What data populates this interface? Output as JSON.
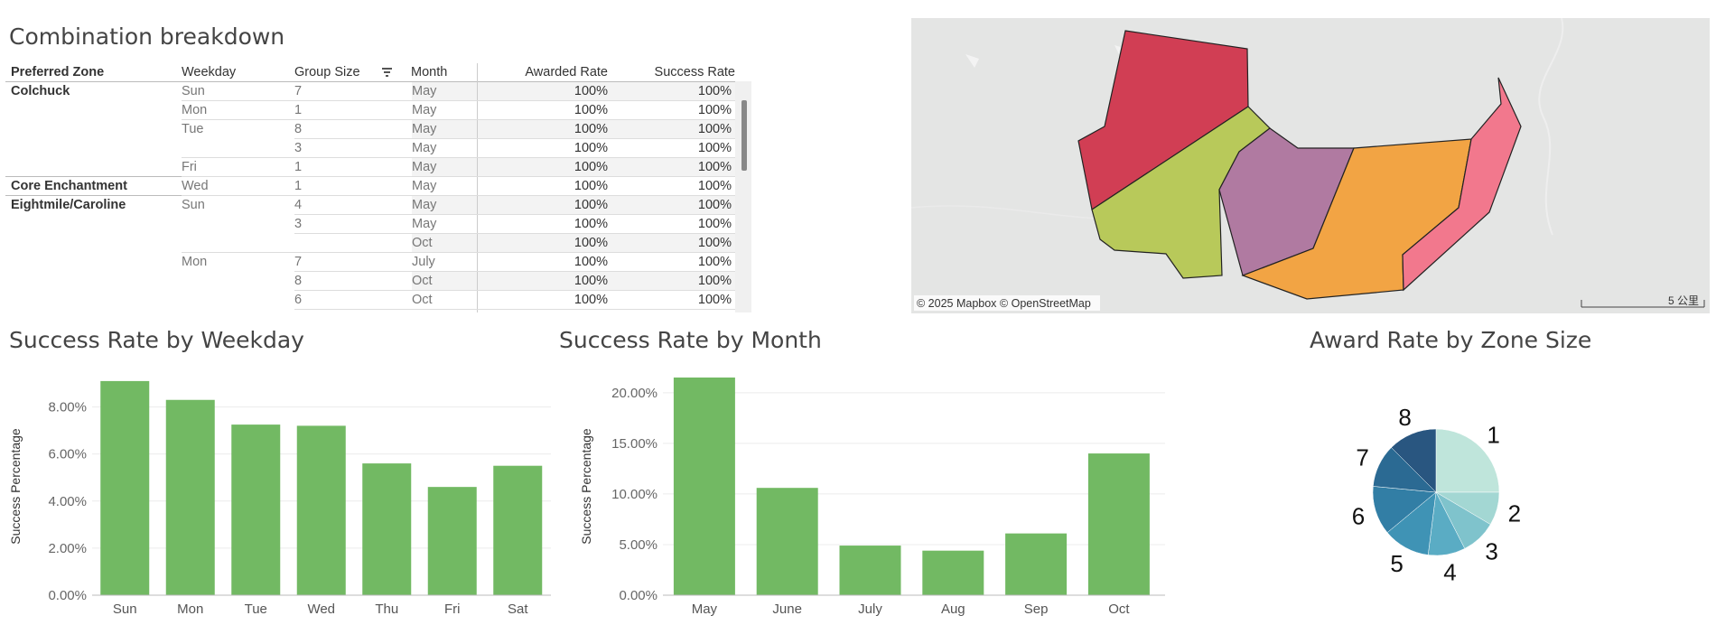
{
  "table": {
    "title": "Combination breakdown",
    "headers": {
      "zone": "Preferred Zone",
      "weekday": "Weekday",
      "group_size": "Group Size",
      "month": "Month",
      "awarded": "Awarded Rate",
      "success": "Success Rate"
    },
    "zones": [
      {
        "label": "Colchuck",
        "row": 0
      },
      {
        "label": "Core Enchantment",
        "row": 5
      },
      {
        "label": "Eightmile/Caroline",
        "row": 6
      }
    ],
    "weekdays": [
      {
        "label": "Sun",
        "row": 0
      },
      {
        "label": "Mon",
        "row": 1
      },
      {
        "label": "Tue",
        "row": 2
      },
      {
        "label": "Fri",
        "row": 4
      },
      {
        "label": "Wed",
        "row": 5
      },
      {
        "label": "Sun",
        "row": 6
      },
      {
        "label": "Mon",
        "row": 9
      }
    ],
    "rows": [
      {
        "size": "7",
        "month": "May",
        "awarded": "100%",
        "success": "100%"
      },
      {
        "size": "1",
        "month": "May",
        "awarded": "100%",
        "success": "100%"
      },
      {
        "size": "8",
        "month": "May",
        "awarded": "100%",
        "success": "100%"
      },
      {
        "size": "3",
        "month": "May",
        "awarded": "100%",
        "success": "100%"
      },
      {
        "size": "1",
        "month": "May",
        "awarded": "100%",
        "success": "100%"
      },
      {
        "size": "1",
        "month": "May",
        "awarded": "100%",
        "success": "100%"
      },
      {
        "size": "4",
        "month": "May",
        "awarded": "100%",
        "success": "100%"
      },
      {
        "size": "3",
        "month": "May",
        "awarded": "100%",
        "success": "100%"
      },
      {
        "size": "",
        "month": "Oct",
        "awarded": "100%",
        "success": "100%"
      },
      {
        "size": "7",
        "month": "July",
        "awarded": "100%",
        "success": "100%"
      },
      {
        "size": "8",
        "month": "Oct",
        "awarded": "100%",
        "success": "100%"
      },
      {
        "size": "6",
        "month": "Oct",
        "awarded": "100%",
        "success": "100%"
      }
    ]
  },
  "map": {
    "attribution": "© 2025 Mapbox © OpenStreetMap",
    "scale_label": "5 公里",
    "zone_colors": [
      "#d13e54",
      "#b8c95a",
      "#b07aa1",
      "#f2a444",
      "#f2788d"
    ]
  },
  "charts": {
    "colors": {
      "bar": "#72b963",
      "pie": [
        "#bfe5db",
        "#a3d7d3",
        "#7fc3cc",
        "#5aacc4",
        "#3f93b5",
        "#327ea5",
        "#2b6a93",
        "#295680"
      ]
    },
    "weekday": {
      "title": "Success Rate by Weekday",
      "ylabel": "Success Percentage",
      "type": "bar",
      "categories": [
        "Sun",
        "Mon",
        "Tue",
        "Wed",
        "Thu",
        "Fri",
        "Sat"
      ],
      "values": [
        9.1,
        8.3,
        7.25,
        7.2,
        5.6,
        4.6,
        5.5
      ],
      "yticks": [
        "0.00%",
        "2.00%",
        "4.00%",
        "6.00%",
        "8.00%"
      ],
      "tickvals": [
        0,
        2,
        4,
        6,
        8
      ],
      "ylim": [
        0,
        9.25
      ]
    },
    "month": {
      "title": "Success Rate by Month",
      "ylabel": "Success Percentage",
      "type": "bar",
      "categories": [
        "May",
        "June",
        "July",
        "Aug",
        "Sep",
        "Oct"
      ],
      "values": [
        21.5,
        10.6,
        4.9,
        4.4,
        6.1,
        14.0
      ],
      "yticks": [
        "0.00%",
        "5.00%",
        "10.00%",
        "15.00%",
        "20.00%"
      ],
      "tickvals": [
        0,
        5,
        10,
        15,
        20
      ],
      "ylim": [
        0,
        21.5
      ]
    },
    "pie": {
      "title": "Award Rate by Zone Size",
      "type": "pie",
      "labels": [
        "1",
        "2",
        "3",
        "4",
        "5",
        "6",
        "7",
        "8"
      ],
      "values": [
        25,
        8.5,
        9,
        9.5,
        12,
        12.5,
        11,
        12.5
      ]
    }
  },
  "chart_data": [
    {
      "type": "bar",
      "title": "Success Rate by Weekday",
      "xlabel": "",
      "ylabel": "Success Percentage",
      "categories": [
        "Sun",
        "Mon",
        "Tue",
        "Wed",
        "Thu",
        "Fri",
        "Sat"
      ],
      "values": [
        9.1,
        8.3,
        7.25,
        7.2,
        5.6,
        4.6,
        5.5
      ],
      "ylim": [
        0,
        9.25
      ],
      "grid": true
    },
    {
      "type": "bar",
      "title": "Success Rate by Month",
      "xlabel": "",
      "ylabel": "Success Percentage",
      "categories": [
        "May",
        "June",
        "July",
        "Aug",
        "Sep",
        "Oct"
      ],
      "values": [
        21.5,
        10.6,
        4.9,
        4.4,
        6.1,
        14.0
      ],
      "ylim": [
        0,
        21.5
      ],
      "grid": true
    },
    {
      "type": "pie",
      "title": "Award Rate by Zone Size",
      "labels": [
        "1",
        "2",
        "3",
        "4",
        "5",
        "6",
        "7",
        "8"
      ],
      "values": [
        25,
        8.5,
        9,
        9.5,
        12,
        12.5,
        11,
        12.5
      ]
    }
  ]
}
